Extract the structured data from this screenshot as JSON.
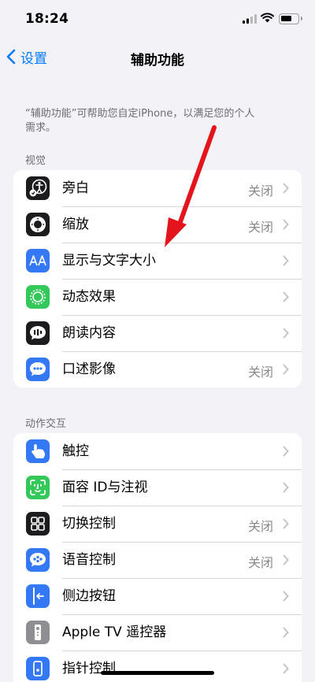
{
  "status_bar": {
    "time": "18:24"
  },
  "nav": {
    "back_label": "设置",
    "title": "辅助功能"
  },
  "intro": {
    "text": "“辅助功能”可帮助您自定iPhone，以满足您的个人需求。"
  },
  "sections": {
    "vision": {
      "header": "视觉",
      "items": [
        {
          "label": "旁白",
          "value": "关闭",
          "icon": "voiceover-icon",
          "color": "#1c1c1e"
        },
        {
          "label": "缩放",
          "value": "关闭",
          "icon": "zoom-icon",
          "color": "#1c1c1e"
        },
        {
          "label": "显示与文字大小",
          "value": "",
          "icon": "text-size-icon",
          "color": "#3478f6"
        },
        {
          "label": "动态效果",
          "value": "",
          "icon": "motion-icon",
          "color": "#34c759"
        },
        {
          "label": "朗读内容",
          "value": "",
          "icon": "speech-icon",
          "color": "#1c1c1e"
        },
        {
          "label": "口述影像",
          "value": "关闭",
          "icon": "audio-description-icon",
          "color": "#3478f6"
        }
      ]
    },
    "interaction": {
      "header": "动作交互",
      "items": [
        {
          "label": "触控",
          "value": "",
          "icon": "touch-icon",
          "color": "#3478f6"
        },
        {
          "label": "面容 ID与注视",
          "value": "",
          "icon": "face-id-icon",
          "color": "#34c759"
        },
        {
          "label": "切换控制",
          "value": "关闭",
          "icon": "switch-control-icon",
          "color": "#1c1c1e"
        },
        {
          "label": "语音控制",
          "value": "关闭",
          "icon": "voice-control-icon",
          "color": "#3478f6"
        },
        {
          "label": "侧边按钮",
          "value": "",
          "icon": "side-button-icon",
          "color": "#3478f6"
        },
        {
          "label": "Apple TV 遥控器",
          "value": "",
          "icon": "remote-icon",
          "color": "#8e8e93"
        },
        {
          "label": "指针控制",
          "value": "",
          "icon": "pointer-control-icon",
          "color": "#3478f6"
        }
      ]
    }
  }
}
